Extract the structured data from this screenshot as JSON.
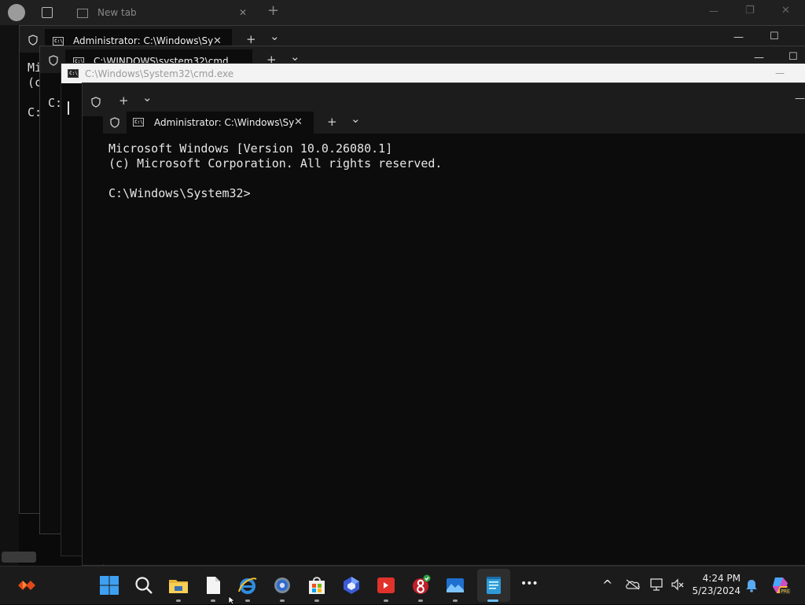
{
  "browser": {
    "tab_label": "New tab",
    "new_tab_glyph": "+",
    "controls": [
      "—",
      "❐",
      "✕"
    ]
  },
  "windows": {
    "back1": {
      "tab_label": "Administrator: C:\\Windows\\Sy",
      "partial_lines": [
        "Mi",
        "(c",
        "C:"
      ]
    },
    "back2": {
      "tab_label": "C:\\WINDOWS\\system32\\cmd",
      "partial_lines": [
        "C:"
      ]
    },
    "conhost": {
      "title": "C:\\Windows\\System32\\cmd.exe"
    },
    "front": {
      "tab_label": "Administrator: C:\\Windows\\Sy",
      "lines": [
        "Microsoft Windows [Version 10.0.26080.1]",
        "(c) Microsoft Corporation. All rights reserved.",
        "",
        "C:\\Windows\\System32>"
      ]
    }
  },
  "tab_controls": {
    "close": "✕",
    "new": "+",
    "dropdown": "⌄",
    "minimize": "—",
    "maximize": "☐"
  },
  "taskbar": {
    "icons": [
      {
        "name": "widgets-icon"
      },
      {
        "name": "start-icon"
      },
      {
        "name": "search-icon"
      },
      {
        "name": "file-explorer-icon"
      },
      {
        "name": "notepad-file-icon"
      },
      {
        "name": "internet-explorer-icon"
      },
      {
        "name": "settings-icon"
      },
      {
        "name": "store-icon"
      },
      {
        "name": "copilot-icon"
      },
      {
        "name": "remote-app-icon"
      },
      {
        "name": "app-8-icon"
      },
      {
        "name": "photos-icon"
      },
      {
        "name": "notepad-icon"
      },
      {
        "name": "more-icon"
      }
    ],
    "more_glyph": "•••",
    "tray_chevron": "^",
    "clock": {
      "time": "4:24 PM",
      "date": "5/23/2024"
    },
    "badge": "PRE"
  },
  "colors": {
    "accent": "#3b8fd9",
    "terminal_bg": "#0c0c0c",
    "terminal_text": "#e6e6e6",
    "taskbar_bg": "#1b1b1b"
  }
}
